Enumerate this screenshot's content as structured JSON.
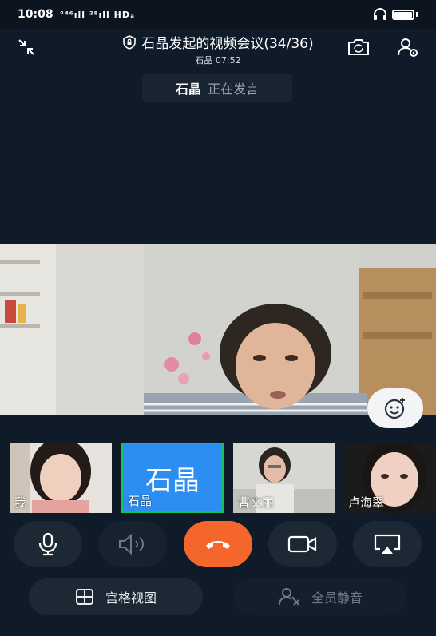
{
  "status_bar": {
    "time": "10:08",
    "signal_text": "°⁴⁶ıll ²⁸ıll HDₐ",
    "icons": [
      "headset-icon",
      "battery-icon"
    ]
  },
  "header": {
    "title": "石晶发起的视频会议(34/36)",
    "subtitle": "石晶 07:52",
    "icons": [
      "minimize-icon",
      "lock-shield-icon",
      "camera-flip-icon",
      "user-settings-icon"
    ]
  },
  "speaker": {
    "name": "石晶",
    "status": "正在发言"
  },
  "participants": [
    {
      "label": "我"
    },
    {
      "label": "石晶",
      "avatar_text": "石晶"
    },
    {
      "label": "曹文丽"
    },
    {
      "label": "卢海翠"
    }
  ],
  "controls": {
    "icons": [
      "microphone-icon",
      "speaker-icon",
      "hangup-icon",
      "video-camera-icon",
      "screen-share-icon"
    ],
    "hangup_color": "#f4662b"
  },
  "bottom": {
    "grid_view_label": "宫格视图",
    "mute_all_label": "全员静音"
  },
  "colors": {
    "background": "#0f1b29",
    "active_border": "#14c35a",
    "avatar_bg": "#2b8ef0"
  }
}
